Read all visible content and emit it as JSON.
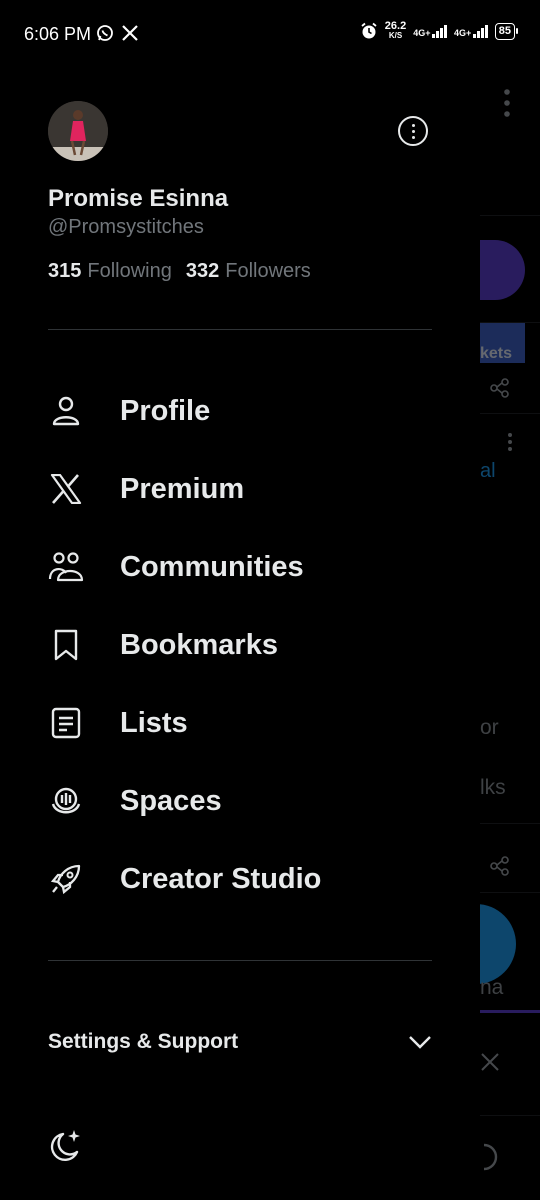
{
  "status_bar": {
    "time": "6:06 PM",
    "speed_value": "26.2",
    "speed_unit": "K/S",
    "net1": "4G+",
    "net2": "4G+",
    "battery": "85"
  },
  "profile": {
    "name": "Promise Esinna",
    "handle": "@Promsystitches",
    "following_count": "315",
    "following_label": "Following",
    "followers_count": "332",
    "followers_label": "Followers"
  },
  "menu": [
    {
      "label": "Profile",
      "icon": "person-icon"
    },
    {
      "label": "Premium",
      "icon": "x-logo-icon"
    },
    {
      "label": "Communities",
      "icon": "communities-icon"
    },
    {
      "label": "Bookmarks",
      "icon": "bookmark-icon"
    },
    {
      "label": "Lists",
      "icon": "list-icon"
    },
    {
      "label": "Spaces",
      "icon": "spaces-icon"
    },
    {
      "label": "Creator Studio",
      "icon": "rocket-icon"
    }
  ],
  "settings": {
    "label": "Settings & Support"
  },
  "peek": {
    "t1": "kets",
    "t2": "al",
    "t3": "or",
    "t4": "lks",
    "t5": "na"
  },
  "colors": {
    "background": "#000000",
    "text": "#e7e9ea",
    "muted": "#71767b",
    "divider": "#2f3336"
  }
}
